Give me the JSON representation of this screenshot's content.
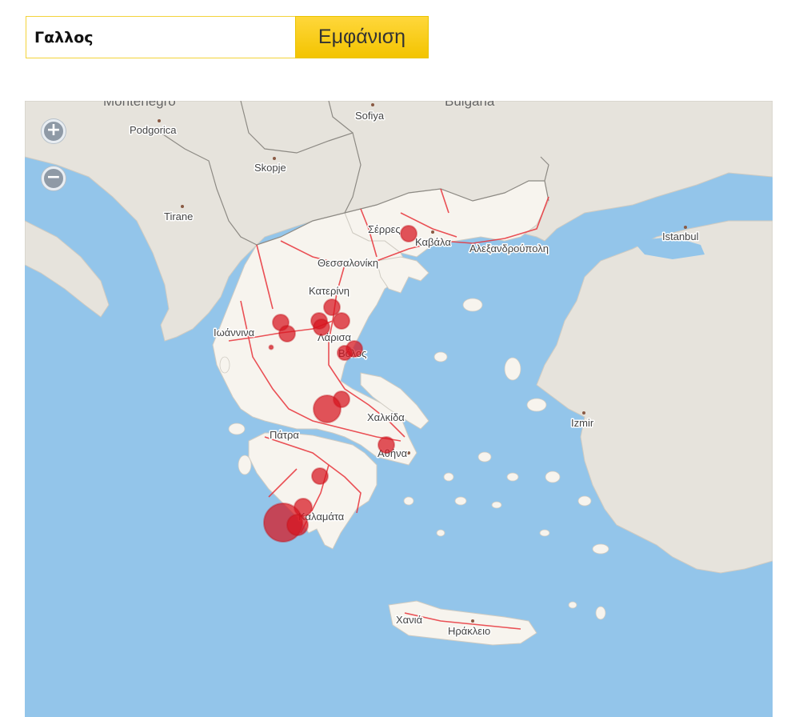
{
  "search": {
    "value": "Γαλλος",
    "button_label": "Εμφάνιση"
  },
  "map": {
    "zoom_in_label": "+",
    "zoom_out_label": "−",
    "water_color": "#93c5ea",
    "land_color": "#e6e3dc",
    "greece_land_color": "#f7f4ee",
    "road_color": "#e8333a",
    "marker_color": "#d7141e",
    "countries": {
      "montenegro": "Montenegro",
      "bulgaria": "Bulgaria"
    },
    "cities": {
      "podgorica": "Podgorica",
      "sofiya": "Sofiya",
      "skopje": "Skopje",
      "tirane": "Tirane",
      "istanbul": "Istanbul",
      "izmir": "Izmir",
      "serres": "Σέρρες",
      "kavala": "Καβάλα",
      "alexandroupoli": "Αλεξανδρούπολη",
      "thessaloniki": "Θεσσαλονίκη",
      "katerini": "Κατερίνη",
      "ioannina": "Ιωάννινα",
      "larisa": "Λάρισα",
      "volos": "Βόλος",
      "chalkida": "Χαλκίδα",
      "patra": "Πάτρα",
      "athina": "Αθήνα",
      "kalamata": "Καλαμάτα",
      "chania": "Χανιά",
      "irakleio": "Ηράκλειο"
    }
  }
}
